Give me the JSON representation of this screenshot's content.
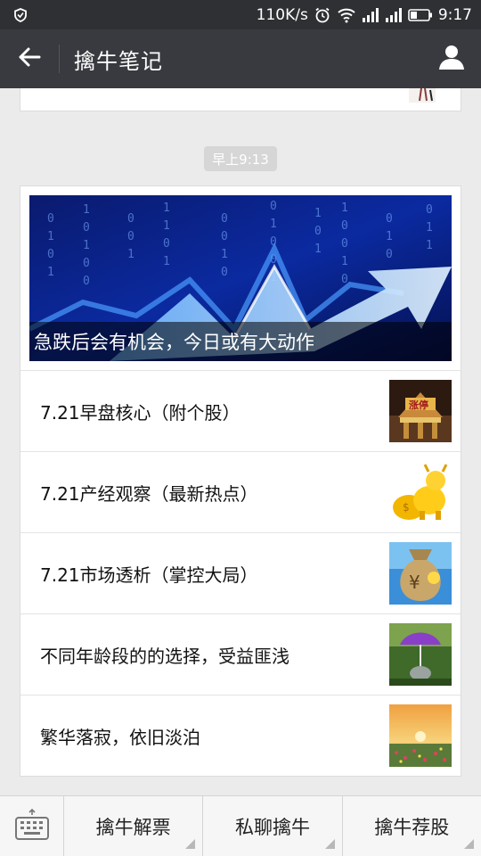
{
  "status_bar": {
    "speed": "110K/s",
    "time": "9:17",
    "icons": [
      "shield-icon",
      "alarm-icon",
      "wifi-icon",
      "signal-icon",
      "signal-icon",
      "battery-icon"
    ]
  },
  "header": {
    "title": "擒牛笔记",
    "back_icon": "arrow-left-icon",
    "profile_icon": "person-icon",
    "bg_color": "#393a3f"
  },
  "timestamp": "早上9:13",
  "article": {
    "cover_title": "急跌后会有机会，今日或有大动作",
    "items": [
      {
        "title": "7.21早盘核心（附个股）",
        "thumb": "stock-hall-thumbnail"
      },
      {
        "title": "7.21产经观察（最新热点）",
        "thumb": "golden-bull-thumbnail"
      },
      {
        "title": "7.21市场透析（掌控大局）",
        "thumb": "money-bag-thumbnail"
      },
      {
        "title": "不同年龄段的的选择，受益匪浅",
        "thumb": "purple-umbrella-thumbnail"
      },
      {
        "title": "繁华落寂，依旧淡泊",
        "thumb": "sunset-field-thumbnail"
      }
    ]
  },
  "bottom_menu": {
    "keyboard_icon": "keyboard-icon",
    "buttons": [
      {
        "label": "擒牛解票"
      },
      {
        "label": "私聊擒牛"
      },
      {
        "label": "擒牛荐股"
      }
    ]
  }
}
